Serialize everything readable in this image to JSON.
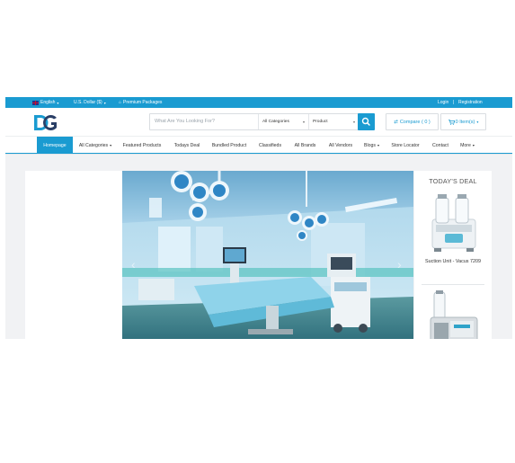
{
  "topbar": {
    "language": "English",
    "currency": "U.S. Dollar ($)",
    "premium": "Premium Packages",
    "login": "Login",
    "registration": "Registration"
  },
  "search": {
    "placeholder": "What Are You Looking For?",
    "category": "All Categories",
    "type": "Product"
  },
  "header": {
    "compare": "Compare ( 0 )",
    "cart": "0 Item(s)"
  },
  "nav": {
    "items": [
      {
        "label": "Homepage",
        "active": true
      },
      {
        "label": "All Categories",
        "dropdown": true
      },
      {
        "label": "Featured Products"
      },
      {
        "label": "Todays Deal"
      },
      {
        "label": "Bundled Product"
      },
      {
        "label": "Classifieds"
      },
      {
        "label": "All Brands"
      },
      {
        "label": "All Vendors"
      },
      {
        "label": "Blogs",
        "dropdown": true
      },
      {
        "label": "Store Locator"
      },
      {
        "label": "Contact"
      },
      {
        "label": "More",
        "dropdown": true
      }
    ]
  },
  "deal": {
    "title": "TODAY'S DEAL",
    "product_name": "Suction Unit - Vacus 7209"
  },
  "colors": {
    "brand": "#1a9bd1"
  }
}
